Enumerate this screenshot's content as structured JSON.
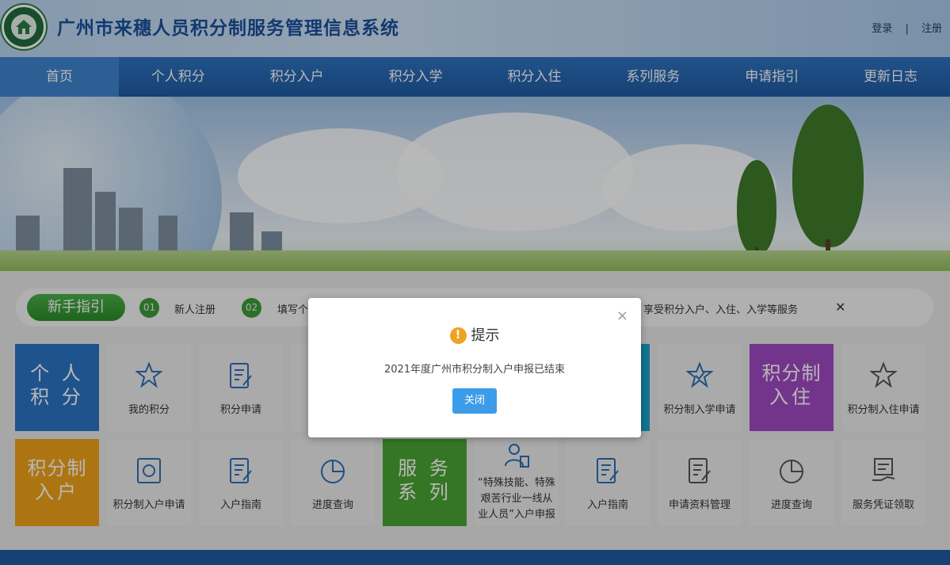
{
  "header": {
    "site_title": "广州市来穗人员积分制服务管理信息系统",
    "login": "登录",
    "separator": "|",
    "register": "注册"
  },
  "nav": {
    "items": [
      "首页",
      "个人积分",
      "积分入户",
      "积分入学",
      "积分入住",
      "系列服务",
      "申请指引",
      "更新日志"
    ],
    "active_index": 0
  },
  "guide": {
    "badge": "新手指引",
    "steps": [
      {
        "num": "01",
        "text": "新人注册"
      },
      {
        "num": "02",
        "text": "填写个"
      }
    ],
    "tail_text": "享受积分入户、入住、入学等服务",
    "close": "✕"
  },
  "tiles_row1": {
    "personal_big": [
      "个 人",
      "积 分"
    ],
    "my_points": "我的积分",
    "points_apply": "积分申请",
    "school_apply": "积分制入学申请",
    "housing_big": [
      "积分制",
      "入住"
    ],
    "housing_apply": "积分制入住申请"
  },
  "tiles_row2": {
    "hukou_big": [
      "积分制",
      "入户"
    ],
    "hukou_apply": "积分制入户申请",
    "hukou_guide": "入户指南",
    "progress": "进度查询",
    "service_big": [
      "服 务",
      "系 列"
    ],
    "special_talent": "“特殊技能、特殊艰苦行业一线从业人员”入户申报",
    "hukou_guide2": "入户指南",
    "material_manage": "申请资料管理",
    "progress2": "进度查询",
    "certificate": "服务凭证领取"
  },
  "modal": {
    "title": "提示",
    "icon": "!",
    "message": "2021年度广州市积分制入户申报已结束",
    "button": "关闭",
    "close": "×"
  },
  "colors": {
    "nav_blue": "#1f5aa3",
    "tile_blue": "#2b74c4",
    "tile_purple": "#a04ac2",
    "tile_orange": "#f0a21a",
    "tile_green": "#4aa432",
    "button_blue": "#3d9ce8",
    "warn_orange": "#f0a322"
  }
}
